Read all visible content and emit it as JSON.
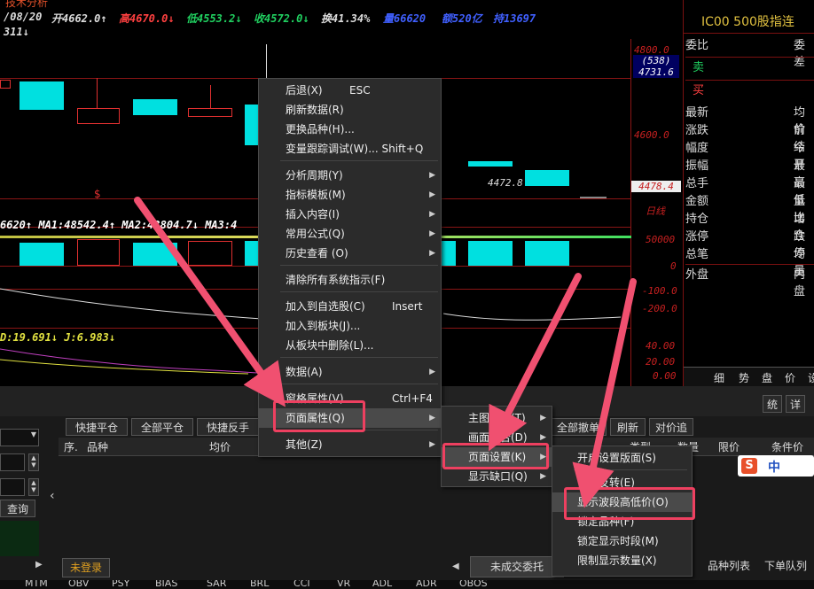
{
  "header": {
    "tab": "技术分析",
    "date": "/08/20",
    "open": "开4662.0↑",
    "high": "高4670.0↓",
    "low": "低4553.2↓",
    "close": "收4572.0↓",
    "turnover": "换41.34%",
    "volume": "量66620",
    "amount": "额520亿",
    "hold": "持13697",
    "sub": "311↓"
  },
  "chart": {
    "price_labels": [
      "4800.0",
      "(538)",
      "4731.6",
      "4600.0",
      "4478.4",
      "日线",
      "50000",
      "0",
      "-100.0",
      "-200.0",
      "40.00",
      "20.00",
      "0.00"
    ],
    "ma_line": "6620↑ MA1:48542.4↑ MA2:43804.7↓ MA3:4",
    "kdj_line": "D:19.691↓ J:6.983↓",
    "low_mark": "4472.8",
    "s_mark": "$"
  },
  "right_panel": {
    "title": "IC00  500股指连",
    "rows": [
      {
        "k": "委比",
        "v": "委差"
      },
      {
        "k": "卖",
        "v": ""
      },
      {
        "k": "买",
        "v": ""
      },
      {
        "k": "最新",
        "v": "均价"
      },
      {
        "k": "涨跌",
        "v": "前结"
      },
      {
        "k": "幅度",
        "v": "今开"
      },
      {
        "k": "振幅",
        "v": "最高"
      },
      {
        "k": "总手",
        "v": "最低"
      },
      {
        "k": "金额",
        "v": "量比"
      },
      {
        "k": "持仓",
        "v": "增仓"
      },
      {
        "k": "涨停",
        "v": "跌停"
      },
      {
        "k": "总笔",
        "v": "均量"
      },
      {
        "k": "外盘",
        "v": "内盘"
      }
    ],
    "tabs": [
      "细",
      "势",
      "盘",
      "价",
      "设"
    ]
  },
  "bottom": {
    "buttons": [
      "快捷平仓",
      "全部平仓",
      "快捷反手"
    ],
    "right_buttons": [
      "全部撤单",
      "刷新",
      "对价追"
    ],
    "top_right": [
      "统",
      "详"
    ],
    "columns_left": [
      "序.",
      "品种",
      "均价"
    ],
    "columns_right": [
      "类型",
      "数量",
      "限价",
      "条件价"
    ],
    "query": "查询",
    "not_logged": "未登录",
    "footer_tabs": [
      "未成交委托",
      "品种列表",
      "下单队列"
    ],
    "indicators": [
      "MTM",
      "OBV",
      "PSY",
      "BIAS",
      "SAR",
      "BRL",
      "CCI",
      "VR",
      "ADL",
      "ADR",
      "OBOS"
    ],
    "ime": "中"
  },
  "menu1": {
    "items": [
      {
        "label": "后退(X)",
        "shortcut": "ESC"
      },
      {
        "label": "刷新数据(R)",
        "shortcut": ""
      },
      {
        "label": "更换品种(H)...",
        "shortcut": ""
      },
      {
        "label": "变量跟踪调试(W)... Shift+Q",
        "shortcut": ""
      },
      {
        "label": "分析周期(Y)",
        "shortcut": ""
      },
      {
        "label": "指标模板(M)",
        "shortcut": ""
      },
      {
        "label": "插入内容(I)",
        "shortcut": ""
      },
      {
        "label": "常用公式(Q)",
        "shortcut": ""
      },
      {
        "label": "历史查看 (O)",
        "shortcut": ""
      },
      {
        "label": "清除所有系统指示(F)",
        "shortcut": ""
      },
      {
        "label": "加入到自选股(C)",
        "shortcut": "Insert"
      },
      {
        "label": "加入到板块(J)...",
        "shortcut": ""
      },
      {
        "label": "从板块中删除(L)...",
        "shortcut": ""
      },
      {
        "label": "数据(A)",
        "shortcut": ""
      },
      {
        "label": "窗格属性(V)",
        "shortcut": "Ctrl+F4"
      },
      {
        "label": "页面属性(Q)",
        "shortcut": ""
      },
      {
        "label": "其他(Z)",
        "shortcut": ""
      }
    ]
  },
  "menu2": {
    "items": [
      "主图类型(T)",
      "画面组合(D)",
      "页面设置(K)",
      "显示缺口(Q)"
    ]
  },
  "menu3": {
    "items": [
      "开启设置版面(S)",
      "价格反转(E)",
      "显示波段高低价(O)",
      "锁定品种(F)",
      "锁定显示时段(M)",
      "限制显示数量(X)"
    ]
  }
}
